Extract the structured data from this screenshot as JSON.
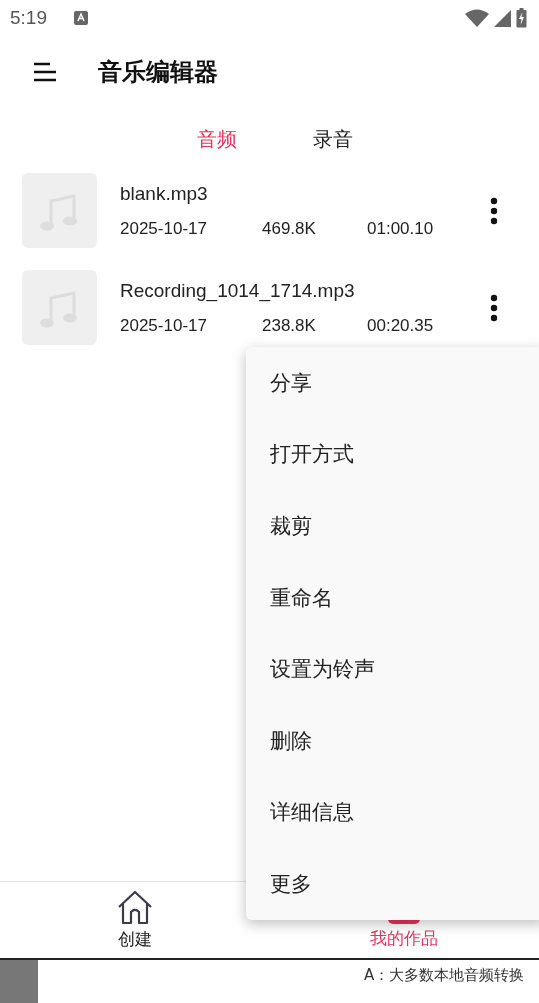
{
  "status_bar": {
    "time": "5:19"
  },
  "app_bar": {
    "title": "音乐编辑器"
  },
  "tabs": [
    {
      "label": "音频",
      "selected": true
    },
    {
      "label": "录音",
      "selected": false
    }
  ],
  "files": [
    {
      "name": "blank.mp3",
      "date": "2025-10-17",
      "size": "469.8K",
      "duration": "01:00.10"
    },
    {
      "name": "Recording_1014_1714.mp3",
      "date": "2025-10-17",
      "size": "238.8K",
      "duration": "00:20.35"
    }
  ],
  "context_menu": {
    "items": [
      "分享",
      "打开方式",
      "裁剪",
      "重命名",
      "设置为铃声",
      "删除",
      "详细信息",
      "更多"
    ]
  },
  "bottom_nav": [
    {
      "label": "创建",
      "selected": false
    },
    {
      "label": "我的作品",
      "selected": true
    }
  ],
  "background_window": {
    "text": "A：大多数本地音频转换"
  }
}
